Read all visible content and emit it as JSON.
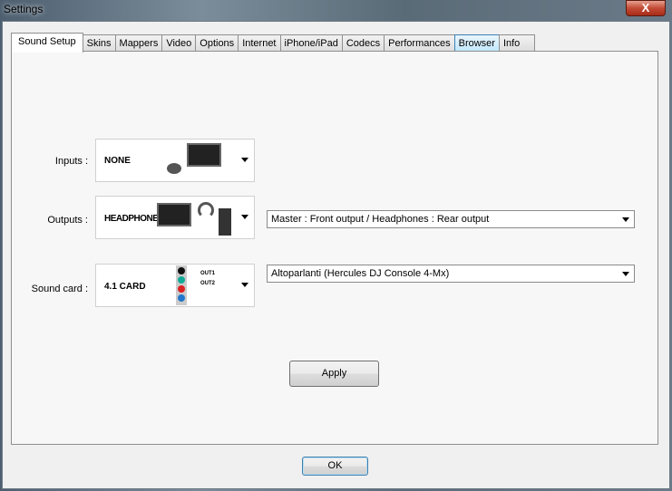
{
  "window": {
    "title": "Settings",
    "close_label": "X"
  },
  "tabs": [
    "Sound Setup",
    "Skins",
    "Mappers",
    "Video",
    "Options",
    "Internet",
    "iPhone/iPad",
    "Codecs",
    "Performances",
    "Browser",
    "Info"
  ],
  "active_tab": "Sound Setup",
  "sound_setup": {
    "inputs": {
      "label": "Inputs :",
      "value": "NONE"
    },
    "outputs": {
      "label": "Outputs :",
      "value": "HEADPHONES",
      "routing": "Master : Front output / Headphones : Rear output"
    },
    "sound_card": {
      "label": "Sound card :",
      "value": "4.1 CARD",
      "out1": "OUT1",
      "out2": "OUT2",
      "device": "Altoparlanti (Hercules DJ Console 4-Mx)"
    },
    "apply_label": "Apply"
  },
  "ok_label": "OK"
}
